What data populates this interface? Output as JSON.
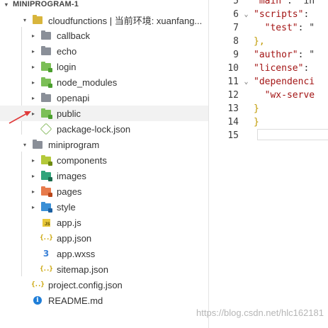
{
  "explorer": {
    "rows": [
      {
        "label": "MINIPROGRAM-1",
        "type": "header",
        "twisty": "▾",
        "icon": "none"
      },
      {
        "label": "cloudfunctions | 当前环境: xuanfang...",
        "type": "folder",
        "twisty": "▾",
        "icon": "folder-open-icon",
        "color": "#d8b53c"
      },
      {
        "label": "callback",
        "type": "folder",
        "twisty": "▸",
        "icon": "folder-icon",
        "color": "#8a8f98"
      },
      {
        "label": "echo",
        "type": "folder",
        "twisty": "▸",
        "icon": "folder-icon",
        "color": "#8a8f98"
      },
      {
        "label": "login",
        "type": "folder",
        "twisty": "▸",
        "icon": "cloud-folder-icon",
        "color": "#7cbf57",
        "badge": "#4a9e2e"
      },
      {
        "label": "node_modules",
        "type": "folder",
        "twisty": "▸",
        "icon": "node-folder-icon",
        "color": "#7cbf57",
        "badge": "#4a9e2e"
      },
      {
        "label": "openapi",
        "type": "folder",
        "twisty": "▸",
        "icon": "folder-icon",
        "color": "#8a8f98"
      },
      {
        "label": "public",
        "type": "folder",
        "twisty": "▸",
        "icon": "cloud-folder-icon",
        "color": "#7cbf57",
        "badge": "#4a9e2e",
        "highlight": true
      },
      {
        "label": "package-lock.json",
        "type": "file",
        "twisty": "",
        "icon": "npm-icon"
      },
      {
        "label": "miniprogram",
        "type": "folder",
        "twisty": "▾",
        "icon": "folder-open-icon",
        "color": "#8a8f98"
      },
      {
        "label": "components",
        "type": "folder",
        "twisty": "▸",
        "icon": "components-folder-icon",
        "color": "#b4c93a",
        "badge": "#6e8a12"
      },
      {
        "label": "images",
        "type": "folder",
        "twisty": "▸",
        "icon": "images-folder-icon",
        "color": "#2fa47a",
        "badge": "#1a6b4e"
      },
      {
        "label": "pages",
        "type": "folder",
        "twisty": "▸",
        "icon": "pages-folder-icon",
        "color": "#e77b4c",
        "badge": "#b8461a"
      },
      {
        "label": "style",
        "type": "folder",
        "twisty": "▸",
        "icon": "style-folder-icon",
        "color": "#3a8fd6",
        "badge": "#1c5fa0"
      },
      {
        "label": "app.js",
        "type": "file",
        "twisty": "",
        "icon": "js-icon"
      },
      {
        "label": "app.json",
        "type": "file",
        "twisty": "",
        "icon": "json-icon"
      },
      {
        "label": "app.wxss",
        "type": "file",
        "twisty": "",
        "icon": "css-icon"
      },
      {
        "label": "sitemap.json",
        "type": "file",
        "twisty": "",
        "icon": "json-icon"
      },
      {
        "label": "project.config.json",
        "type": "file",
        "twisty": "",
        "icon": "json-icon"
      },
      {
        "label": "README.md",
        "type": "file",
        "twisty": "",
        "icon": "info-icon"
      }
    ]
  },
  "editor": {
    "lines": [
      {
        "num": "5",
        "fold": "",
        "parts": [
          {
            "t": "\"main\"",
            "c": "k"
          },
          {
            "t": ": \"in",
            "c": "p"
          }
        ]
      },
      {
        "num": "6",
        "fold": "⌄",
        "parts": [
          {
            "t": "\"scripts\"",
            "c": "k"
          },
          {
            "t": ": ",
            "c": "p"
          }
        ]
      },
      {
        "num": "7",
        "fold": "",
        "parts": [
          {
            "t": "  \"test\"",
            "c": "k"
          },
          {
            "t": ": \"",
            "c": "p"
          }
        ]
      },
      {
        "num": "8",
        "fold": "",
        "parts": [
          {
            "t": "},",
            "c": "b"
          }
        ]
      },
      {
        "num": "9",
        "fold": "",
        "parts": [
          {
            "t": "\"author\"",
            "c": "k"
          },
          {
            "t": ": \"",
            "c": "p"
          }
        ]
      },
      {
        "num": "10",
        "fold": "",
        "parts": [
          {
            "t": "\"license\"",
            "c": "k"
          },
          {
            "t": ": ",
            "c": "p"
          }
        ]
      },
      {
        "num": "11",
        "fold": "⌄",
        "parts": [
          {
            "t": "\"dependenci",
            "c": "k"
          }
        ]
      },
      {
        "num": "12",
        "fold": "",
        "parts": [
          {
            "t": "  \"wx-serve",
            "c": "k"
          }
        ]
      },
      {
        "num": "13",
        "fold": "",
        "parts": [
          {
            "t": "}",
            "c": "b"
          }
        ]
      },
      {
        "num": "14",
        "fold": "",
        "parts": [
          {
            "t": "}",
            "c": "b"
          }
        ]
      },
      {
        "num": "15",
        "fold": "",
        "parts": [
          {
            "t": "",
            "c": "p"
          }
        ]
      }
    ]
  },
  "watermark": "https://blog.csdn.net/hlc162181",
  "colors": {
    "accent_arrow": "#e03a3a",
    "highlight": "#f2f2f2"
  }
}
